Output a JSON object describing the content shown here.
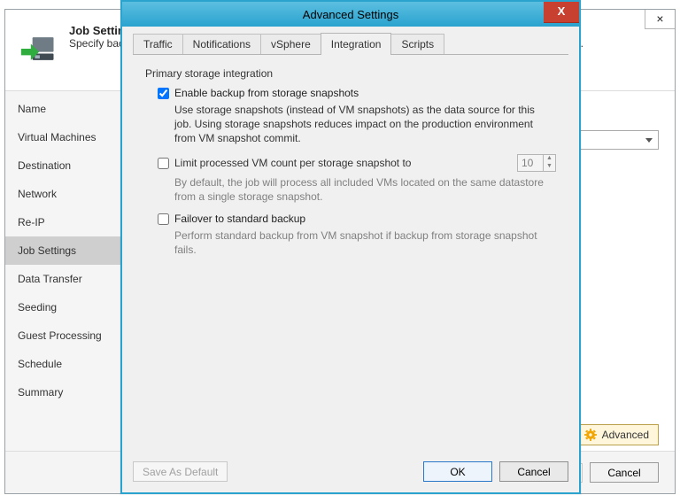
{
  "wizard": {
    "title": "Job Settings",
    "subtitle": "Specify backup repository and retention policy for the replica metadata, and customize advanced job settings.",
    "close_label": "×",
    "nav": [
      "Name",
      "Virtual Machines",
      "Destination",
      "Network",
      "Re-IP",
      "Job Settings",
      "Data Transfer",
      "Seeding",
      "Guest Processing",
      "Schedule",
      "Summary"
    ],
    "nav_selected_index": 5,
    "advanced_button": "Advanced",
    "footer": {
      "cancel": "Cancel"
    }
  },
  "modal": {
    "title": "Advanced Settings",
    "close_label": "X",
    "tabs": [
      "Traffic",
      "Notifications",
      "vSphere",
      "Integration",
      "Scripts"
    ],
    "active_tab_index": 3,
    "integration": {
      "group_title": "Primary storage integration",
      "enable": {
        "label": "Enable backup from storage snapshots",
        "checked": true,
        "desc": "Use storage snapshots (instead of VM snapshots) as the data source for this job. Using storage snapshots reduces impact on the production environment from VM snapshot commit."
      },
      "limit": {
        "label": "Limit processed VM count per storage snapshot to",
        "checked": false,
        "value": "10",
        "desc": "By default, the job will process all included VMs located on the same datastore from a single storage snapshot."
      },
      "failover": {
        "label": "Failover to standard backup",
        "checked": false,
        "desc": "Perform standard backup from VM snapshot if backup from storage snapshot fails."
      }
    },
    "buttons": {
      "save_default": "Save As Default",
      "ok": "OK",
      "cancel": "Cancel"
    }
  },
  "colors": {
    "accent": "#2aa3cf",
    "close_red": "#c74030",
    "advanced_bg": "#fff6dc"
  }
}
